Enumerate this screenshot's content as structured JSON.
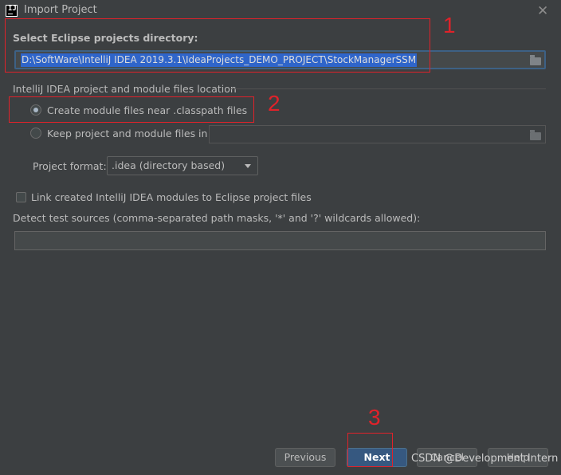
{
  "window": {
    "title": "Import Project"
  },
  "directory": {
    "label": "Select Eclipse projects directory:",
    "path": "D:\\SoftWare\\IntelliJ IDEA 2019.3.1\\IdeaProjects_DEMO_PROJECT\\StockManagerSSM"
  },
  "location": {
    "section_label": "IntelliJ IDEA project and module files location",
    "option_near": "Create module files near .classpath files",
    "option_keep": "Keep project and module files in",
    "keep_path": "",
    "selected": "near"
  },
  "format": {
    "label": "Project format:",
    "value": ".idea (directory based)"
  },
  "link": {
    "label": "Link created IntelliJ IDEA modules to Eclipse project files",
    "checked": false
  },
  "test_sources": {
    "label": "Detect test sources (comma-separated path masks, '*' and '?' wildcards allowed):",
    "value": ""
  },
  "buttons": {
    "previous": "Previous",
    "next": "Next",
    "cancel": "Cancel",
    "help": "Help"
  },
  "annotations": {
    "one": "1",
    "two": "2",
    "three": "3"
  },
  "watermark": "CSDN @Development Intern",
  "icons": {
    "app": "IJ",
    "close": "✕"
  },
  "colors": {
    "background": "#3c3f41",
    "selection": "#2f65ca",
    "primary_button": "#365880",
    "annotation": "#e0222a"
  }
}
